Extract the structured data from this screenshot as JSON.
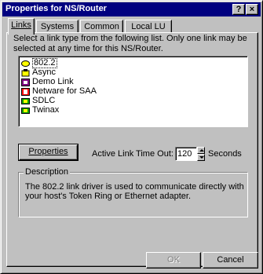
{
  "window": {
    "title": "Properties for NS/Router"
  },
  "titlebar_buttons": {
    "help": "?",
    "close": "×"
  },
  "tabs": [
    {
      "label": "Links"
    },
    {
      "label": "Systems"
    },
    {
      "label": "Common"
    },
    {
      "label": "Local LU"
    }
  ],
  "instructions": "Select a link type from the following list. Only one link may be selected at any time for this NS/Router.",
  "links": [
    {
      "label": "802.2",
      "icon": "token-ring-icon",
      "selected": true
    },
    {
      "label": "Async",
      "icon": "async-link-icon"
    },
    {
      "label": "Demo Link",
      "icon": "demo-link-icon"
    },
    {
      "label": "Netware for SAA",
      "icon": "netware-icon"
    },
    {
      "label": "SDLC",
      "icon": "sdlc-link-icon"
    },
    {
      "label": "Twinax",
      "icon": "twinax-link-icon"
    }
  ],
  "properties_button": "Properties",
  "timeout": {
    "label": "Active Link Time Out:",
    "value": "120",
    "unit": "Seconds"
  },
  "description": {
    "title": "Description",
    "text": "The 802.2 link driver is used to communicate directly with your host's Token Ring or Ethernet adapter."
  },
  "footer": {
    "ok": "OK",
    "cancel": "Cancel"
  },
  "colors": {
    "titlebar": "#000080",
    "face": "#c0c0c0",
    "selected_icon": "#ffff00"
  }
}
